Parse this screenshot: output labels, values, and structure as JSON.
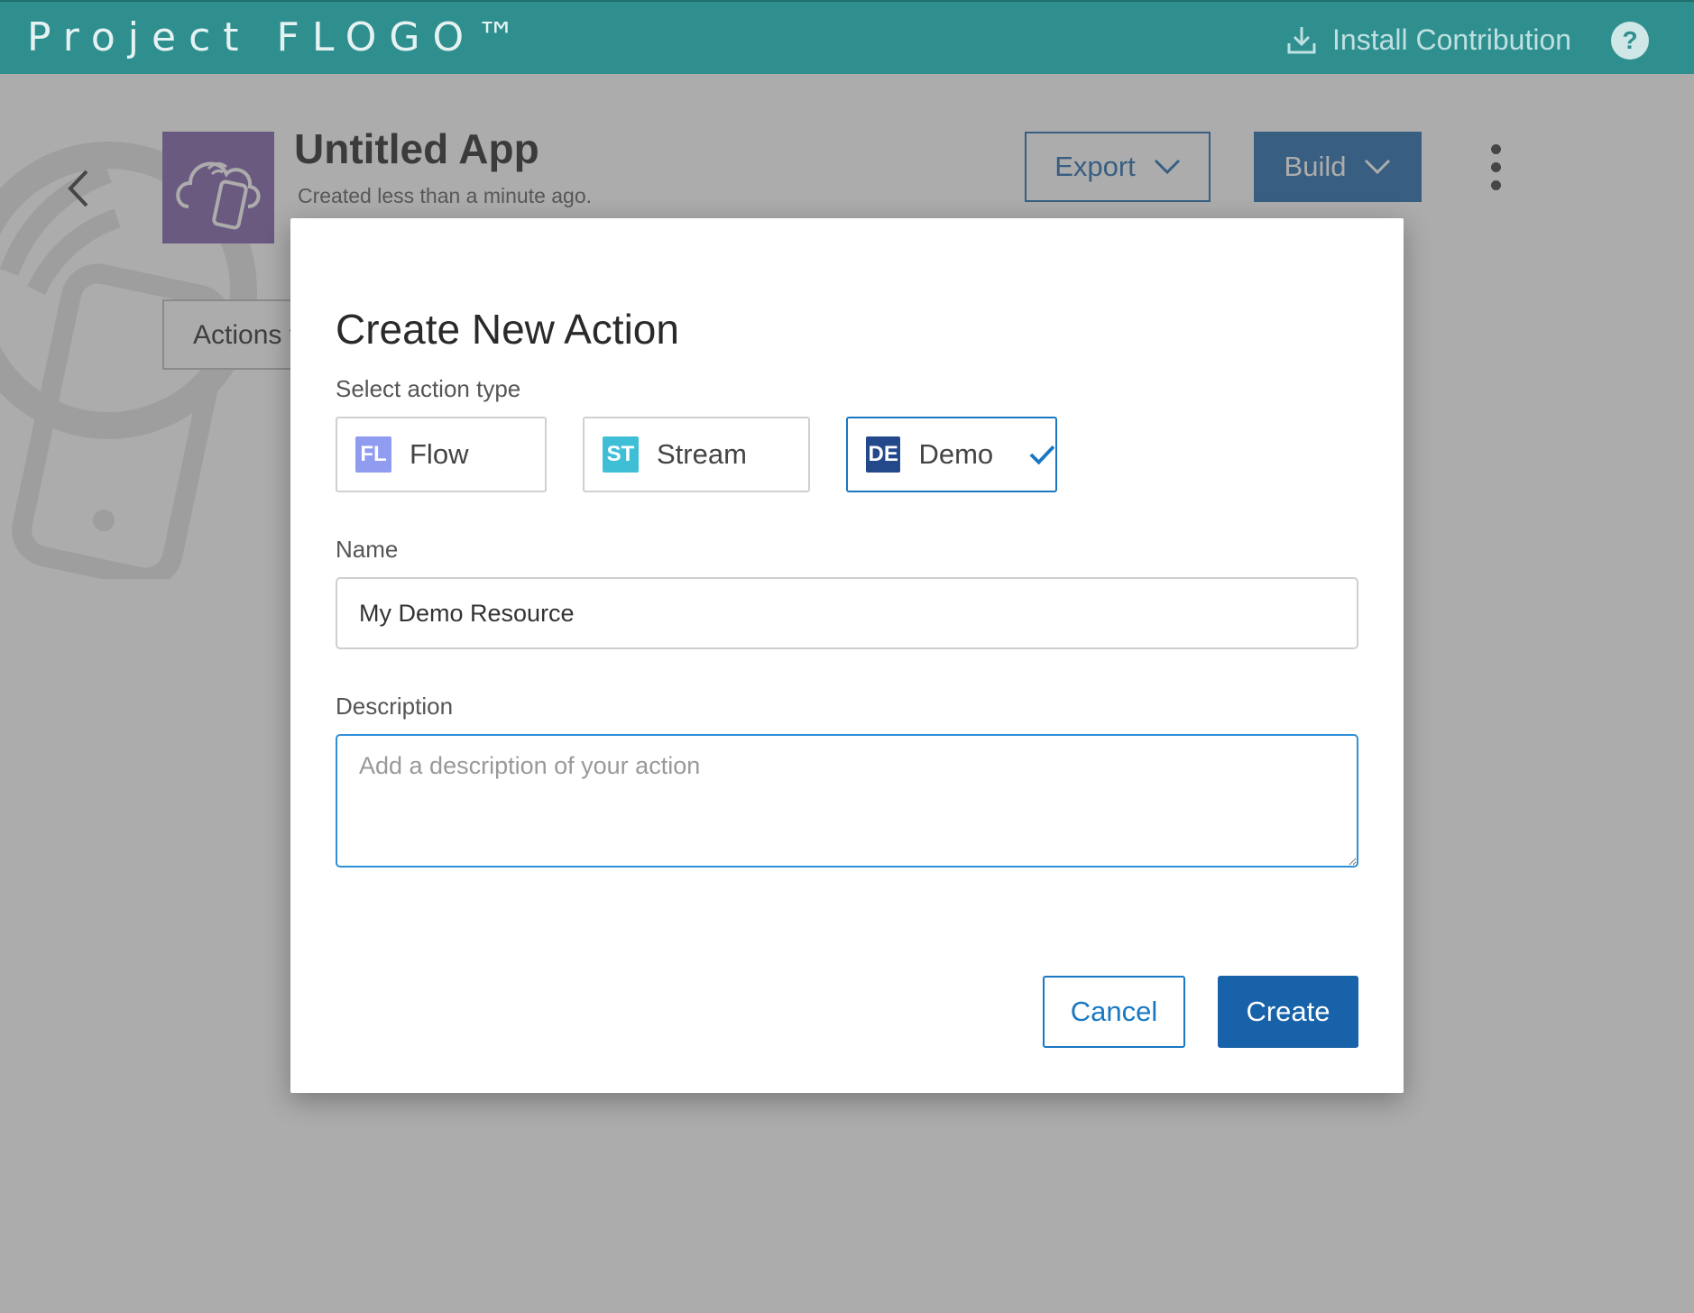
{
  "header": {
    "brand": "Project FLOGO™",
    "install_label": "Install Contribution",
    "help_label": "?"
  },
  "app": {
    "title": "Untitled App",
    "subtitle": "Created less than a minute ago.",
    "export_label": "Export",
    "build_label": "Build",
    "actions_tab_label": "Actions ▾"
  },
  "modal": {
    "title": "Create New Action",
    "type_label": "Select action type",
    "types": [
      {
        "code": "FL",
        "label": "Flow",
        "color": "#8f9cf0",
        "selected": false
      },
      {
        "code": "ST",
        "label": "Stream",
        "color": "#3fbfd6",
        "selected": false
      },
      {
        "code": "DE",
        "label": "Demo",
        "color": "#23498a",
        "selected": true
      }
    ],
    "name_label": "Name",
    "name_value": "My Demo Resource",
    "description_label": "Description",
    "description_placeholder": "Add a description of your action",
    "cancel_label": "Cancel",
    "create_label": "Create"
  },
  "colors": {
    "header_bg": "#2f8f8f",
    "primary": "#1762a8",
    "focus": "#2f8fd9",
    "app_icon_bg": "#7b5aa6"
  }
}
